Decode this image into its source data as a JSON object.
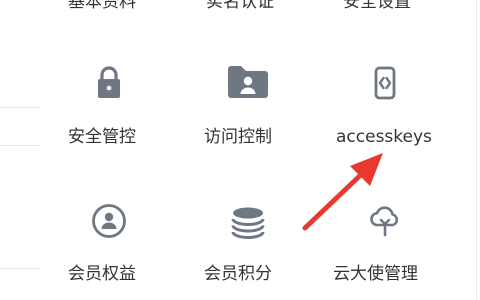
{
  "menu": {
    "row0": [
      "基本资料",
      "实名认证",
      "安全设置"
    ],
    "row1": [
      {
        "label": "安全管控",
        "icon": "lock-icon"
      },
      {
        "label": "访问控制",
        "icon": "folder-user-icon"
      },
      {
        "label": "accesskeys",
        "icon": "code-device-icon"
      }
    ],
    "row2": [
      {
        "label": "会员权益",
        "icon": "member-circle-icon"
      },
      {
        "label": "会员积分",
        "icon": "coin-stack-icon"
      },
      {
        "label": "云大使管理",
        "icon": "cloud-ambassador-icon"
      }
    ]
  },
  "colors": {
    "icon": "#6f7782",
    "text": "#333333",
    "arrow": "#e8382f"
  }
}
